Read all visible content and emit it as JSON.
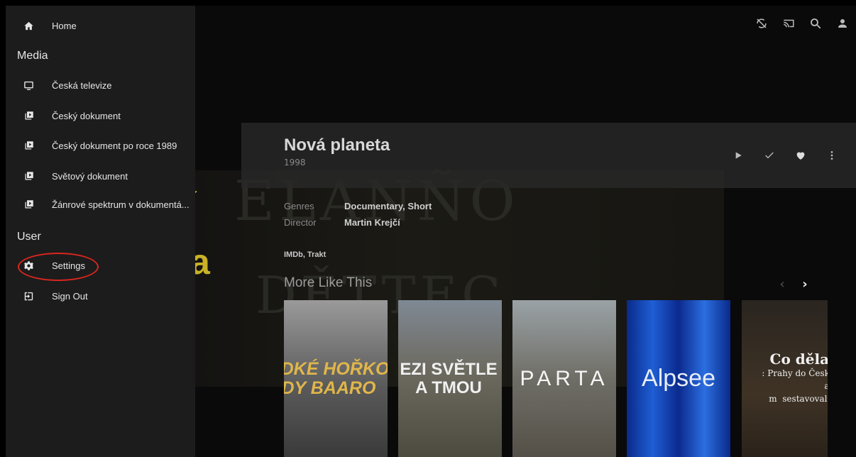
{
  "sidebar": {
    "home": {
      "label": "Home",
      "icon": "home-icon"
    },
    "media_header": "Media",
    "media_items": [
      {
        "label": "Česká televize",
        "icon": "tv-icon"
      },
      {
        "label": "Český dokument",
        "icon": "video-library-icon"
      },
      {
        "label": "Český dokument po roce 1989",
        "icon": "video-library-icon"
      },
      {
        "label": "Světový dokument",
        "icon": "video-library-icon"
      },
      {
        "label": "Žánrové spektrum v dokumentá...",
        "icon": "video-library-icon"
      }
    ],
    "user_header": "User",
    "settings": {
      "label": "Settings",
      "icon": "gear-icon"
    },
    "sign_out": {
      "label": "Sign Out",
      "icon": "sign-out-icon"
    },
    "highlight_color": "#d8261f"
  },
  "toolbar": {
    "icons": [
      "sync-disabled-icon",
      "cast-icon",
      "search-icon",
      "user-icon"
    ]
  },
  "detail": {
    "title": "Nová planeta",
    "year": "1998",
    "genres_label": "Genres",
    "genres_value": "Documentary, Short",
    "director_label": "Director",
    "director_value": "Martin Krejčí",
    "links": "IMDb, Trakt",
    "actions": [
      "play-icon",
      "check-icon",
      "heart-icon",
      "more-vertical-icon"
    ],
    "backdrop_fragments": [
      "í",
      "a"
    ],
    "backdrop_letters": [
      "ELANÑO",
      "DĚTTEC"
    ]
  },
  "more_like_this": {
    "title": "More Like This",
    "prev": "‹",
    "next": "›",
    "cards": [
      {
        "title": "ADKÉ HOŘKO\nDY BAARO"
      },
      {
        "title": "EZI SVĚTLE\nA TMOU"
      },
      {
        "title": "PARTA"
      },
      {
        "title": "Alpsee"
      },
      {
        "title": "Co dělat?",
        "sub": ": Prahy do Českého\naneb\nm  sestavoval nov"
      }
    ]
  }
}
